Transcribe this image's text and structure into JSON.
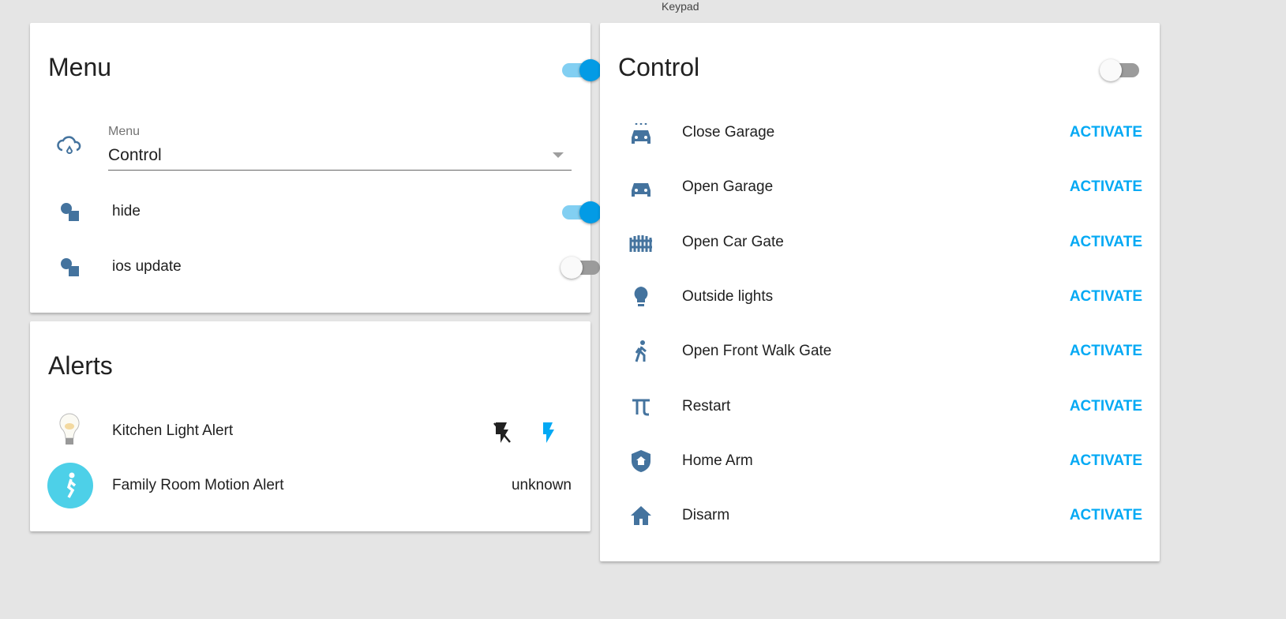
{
  "top_label": "Keypad",
  "menu_card": {
    "title": "Menu",
    "toggle_on": true,
    "select": {
      "label": "Menu",
      "value": "Control"
    },
    "items": [
      {
        "label": "hide",
        "on": true
      },
      {
        "label": "ios update",
        "on": false
      }
    ]
  },
  "alerts_card": {
    "title": "Alerts",
    "items": [
      {
        "label": "Kitchen Light Alert"
      },
      {
        "label": "Family Room Motion Alert",
        "state": "unknown"
      }
    ]
  },
  "control_card": {
    "title": "Control",
    "toggle_on": false,
    "items": [
      {
        "label": "Close Garage",
        "icon": "garage-close-icon",
        "action": "ACTIVATE"
      },
      {
        "label": "Open Garage",
        "icon": "car-icon",
        "action": "ACTIVATE"
      },
      {
        "label": "Open Car Gate",
        "icon": "gate-icon",
        "action": "ACTIVATE"
      },
      {
        "label": "Outside lights",
        "icon": "lightbulb-icon",
        "action": "ACTIVATE"
      },
      {
        "label": "Open Front Walk Gate",
        "icon": "walk-icon",
        "action": "ACTIVATE"
      },
      {
        "label": "Restart",
        "icon": "pi-icon",
        "action": "ACTIVATE"
      },
      {
        "label": "Home Arm",
        "icon": "shield-home-icon",
        "action": "ACTIVATE"
      },
      {
        "label": "Disarm",
        "icon": "home-icon",
        "action": "ACTIVATE"
      }
    ]
  },
  "colors": {
    "accent": "#03a9f4",
    "icon": "#44739e"
  }
}
